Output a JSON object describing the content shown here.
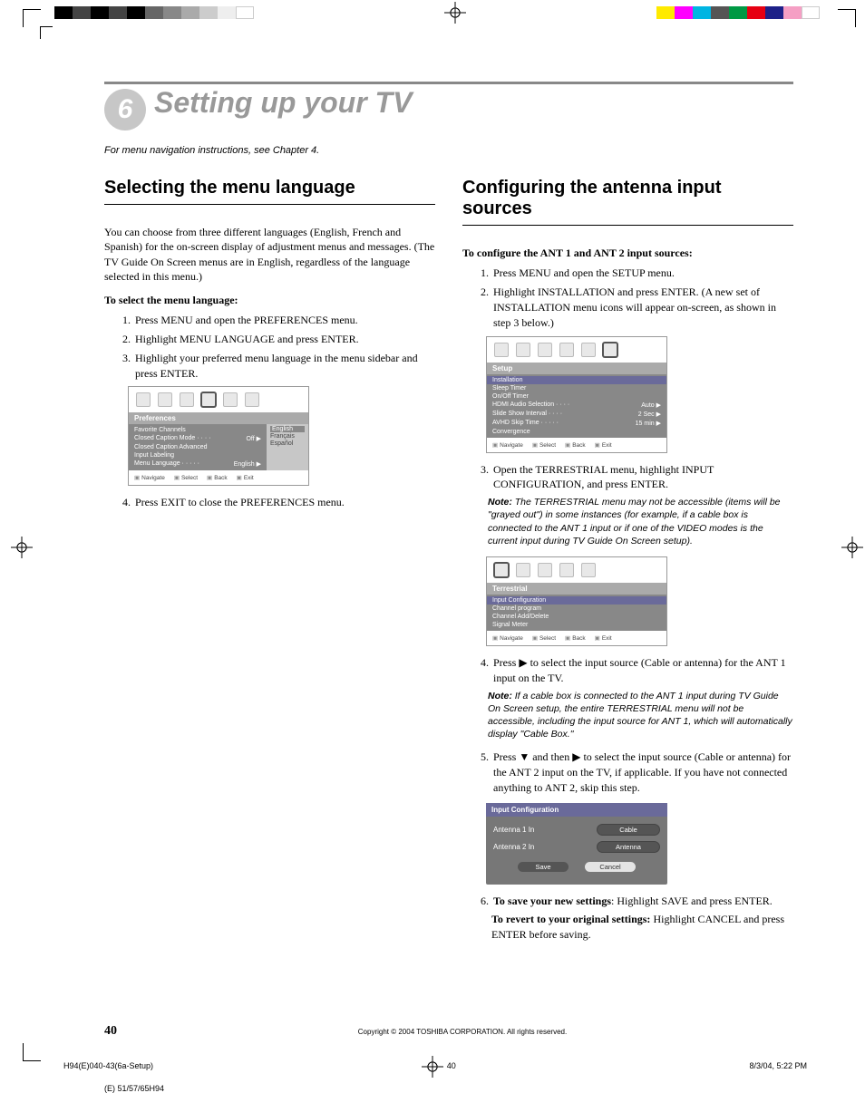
{
  "chapter": {
    "number": "6",
    "title": "Setting up your TV",
    "sub": "For menu navigation instructions, see Chapter 4."
  },
  "left": {
    "heading": "Selecting the menu language",
    "intro": "You can choose from three different languages (English, French and Spanish) for the on-screen display of adjustment menus and messages. (The TV Guide On Screen menus are in English, regardless of the language selected in this menu.)",
    "lead": "To select the menu language:",
    "steps": [
      "Press MENU and open the PREFERENCES menu.",
      "Highlight MENU LANGUAGE and press ENTER.",
      "Highlight your preferred menu language in the menu sidebar and press ENTER.",
      "Press EXIT to close the PREFERENCES menu."
    ],
    "osd": {
      "tab": "Preferences",
      "items": [
        {
          "l": "Favorite Channels",
          "r": ""
        },
        {
          "l": "Closed Caption Mode · · · ·",
          "r": "Off ▶"
        },
        {
          "l": "Closed Caption Advanced",
          "r": ""
        },
        {
          "l": "Input Labeling",
          "r": ""
        },
        {
          "l": "Menu Language · · · · ·",
          "r": "English ▶"
        }
      ],
      "lang": [
        "English",
        "Français",
        "Español"
      ],
      "nav": [
        "Navigate",
        "Select",
        "Back",
        "Exit"
      ]
    }
  },
  "right": {
    "heading": "Configuring the antenna input sources",
    "lead": "To configure the ANT 1 and ANT 2 input sources:",
    "step1": "Press MENU and open the SETUP menu.",
    "step2": "Highlight INSTALLATION and press ENTER. (A new set of INSTALLATION menu icons will appear on-screen, as shown in step 3 below.)",
    "osd_setup": {
      "tab": "Setup",
      "items": [
        {
          "l": "Installation",
          "r": "",
          "sel": true
        },
        {
          "l": "Sleep Timer",
          "r": ""
        },
        {
          "l": "On/Off Timer",
          "r": ""
        },
        {
          "l": "HDMI Audio Selection · · · ·",
          "r": "Auto ▶"
        },
        {
          "l": "Slide Show Interval · · · ·",
          "r": "2 Sec ▶"
        },
        {
          "l": "AVHD Skip Time · · · · ·",
          "r": "15 min ▶"
        },
        {
          "l": "Convergence",
          "r": ""
        }
      ],
      "nav": [
        "Navigate",
        "Select",
        "Back",
        "Exit"
      ]
    },
    "step3": "Open the TERRESTRIAL menu, highlight INPUT CONFIGURATION, and press ENTER.",
    "note3_label": "Note:",
    "note3": "The TERRESTRIAL menu may not be accessible (items will be \"grayed out\") in some instances (for example, if a cable box is connected to the ANT 1 input or if one of the VIDEO modes is the current input during TV Guide On Screen setup).",
    "osd_terr": {
      "tab": "Terrestrial",
      "items": [
        {
          "l": "Input Configuration",
          "sel": true
        },
        {
          "l": "Channel program"
        },
        {
          "l": "Channel Add/Delete"
        },
        {
          "l": "Signal Meter"
        }
      ],
      "nav": [
        "Navigate",
        "Select",
        "Back",
        "Exit"
      ]
    },
    "step4_a": "Press ",
    "step4_b": " to select the input source (Cable or antenna) for the ANT 1 input on the TV.",
    "note4_label": "Note:",
    "note4": "If a cable box is connected to the ANT 1 input during TV Guide On Screen setup, the entire TERRESTRIAL menu will not be accessible, including the input source for ANT 1, which will automatically display \"Cable Box.\"",
    "step5_a": "Press ",
    "step5_b": " and then ",
    "step5_c": " to select the input source (Cable or antenna) for the ANT 2 input on the TV, if applicable. If you have not connected anything to ANT 2, skip this step.",
    "inputcfg": {
      "title": "Input Configuration",
      "rows": [
        {
          "l": "Antenna 1 In",
          "v": "Cable",
          "dark": true
        },
        {
          "l": "Antenna 2 In",
          "v": "Antenna",
          "dark": true
        }
      ],
      "save": "Save",
      "cancel": "Cancel"
    },
    "step6_lead": "To save your new settings",
    "step6_rest": ": Highlight SAVE and press ENTER.",
    "revert_lead": "To revert to your original settings:",
    "revert_rest": " Highlight CANCEL and press ENTER before saving."
  },
  "footer": {
    "pagenum": "40",
    "copyright": "Copyright © 2004 TOSHIBA CORPORATION. All rights reserved.",
    "file": "H94(E)040-43(6a-Setup)",
    "filepage": "40",
    "date": "8/3/04, 5:22 PM",
    "model": "(E) 51/57/65H94"
  },
  "swatches_left": [
    "#000",
    "#444",
    "#000",
    "#444",
    "#000",
    "#666",
    "#888",
    "#aaa",
    "#ccc",
    "#eee",
    "#fff"
  ],
  "swatches_right": [
    "#ffea00",
    "#ff00ff",
    "#00b5e2",
    "#555",
    "#009944",
    "#e60012",
    "#1d2088",
    "#f59fc4",
    "#fff"
  ]
}
